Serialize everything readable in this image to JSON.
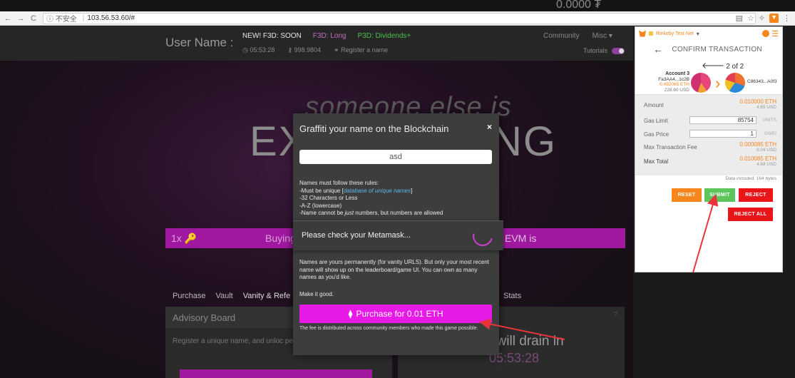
{
  "browser": {
    "nav_back": "←",
    "nav_forward": "→",
    "reload": "C",
    "security": "ⓘ 不安全",
    "url": "103.56.53.60/#",
    "ghost_text": "0.0000 ₮"
  },
  "site": {
    "user_name": "User Name :",
    "links": {
      "new_soon": "NEW! F3D: SOON",
      "f3d_long": "F3D: Long",
      "p3d": "P3D: Dividends+"
    },
    "stats": {
      "timer": "05:53:28",
      "keys": "998.9804",
      "register": "Register a name"
    },
    "community": "Community",
    "misc": "Misc ▾",
    "tutorials": "Tutorials",
    "hero_top": "someone else is",
    "hero_left": "EX",
    "hero_right": "NG",
    "buy_bar": {
      "left": "1x 🔑",
      "buying": "Buying",
      "evm": "EVM is"
    },
    "tabs": [
      "Purchase",
      "Vault",
      "Vanity & Refe"
    ],
    "stats_tab": "Stats",
    "advisory_board": "Advisory Board",
    "advisory_text": "Register a unique name, and unloc permanently.",
    "drain_text": "t will drain in",
    "drain_time": "05:53:28",
    "question": "?"
  },
  "modal": {
    "title": "Graffiti your name on the Blockchain",
    "close": "×",
    "name_value": "asd",
    "rules_title": "Names must follow these rules:",
    "rule_unique_prefix": "-Must be unique [",
    "rule_unique_link": "database of unique names",
    "rule_unique_suffix": "]",
    "rule_length": "-32 Characters or Less",
    "rule_chars": "-A-Z (lowercase)",
    "rule_numbers_prefix": "-Name cannot be ",
    "rule_numbers_em": "just",
    "rule_numbers_suffix": " numbers, but numbers are allowed",
    "permanent_text": "Names are yours permanently (for vanity URLS). But only your most recent name will show up on the leaderboard/game UI. You can own as many names as you'd like.",
    "make_good": "Make it good.",
    "purchase_label": "Purchase for 0.01 ETH",
    "fee_text": "The fee is distributed across community members who made this game possible."
  },
  "check_banner": {
    "text": "Please check your Metamask..."
  },
  "metamask": {
    "network": "Rinkeby Test Net",
    "caret": "▾",
    "header": "CONFIRM TRANSACTION",
    "pager": "2 of 2",
    "from_name": "Account 3",
    "from_addr": "Fa3AA4...1c2B",
    "from_eth": "0.492065 ETH",
    "from_usd": "228.60 USD",
    "to_addr": "C86343...A0f3",
    "amount_label": "Amount",
    "amount_eth": "0.010000 ETH",
    "amount_usd": "4.65 USD",
    "gas_limit_label": "Gas Limit",
    "gas_limit": "85754",
    "gas_limit_unit": "UNITS",
    "gas_price_label": "Gas Price",
    "gas_price": "1",
    "gas_price_unit": "GWEI",
    "max_fee_label": "Max Transaction Fee",
    "max_fee_eth": "0.000085 ETH",
    "max_fee_usd": "0.04 USD",
    "max_total_label": "Max Total",
    "max_total_eth": "0.010085 ETH",
    "max_total_usd": "4.69 USD",
    "data_included": "Data included: 164 bytes",
    "reset": "RESET",
    "submit": "SUBMIT",
    "reject": "REJECT",
    "reject_all": "REJECT ALL"
  },
  "colors": {
    "magenta": "#e619e6",
    "metamask_orange": "#f6851b",
    "submit_green": "#5cc55c",
    "reject_red": "#e91518",
    "annotation_red": "#e8343a"
  }
}
